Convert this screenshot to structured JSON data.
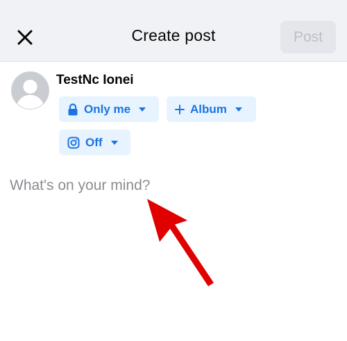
{
  "header": {
    "title": "Create post",
    "post_label": "Post"
  },
  "user": {
    "name": "TestNc Ionei"
  },
  "audience": {
    "privacy_label": "Only me",
    "album_label": "Album",
    "instagram_label": "Off"
  },
  "composer": {
    "placeholder": "What's on your mind?"
  },
  "colors": {
    "accent": "#1b74e4",
    "pill_bg": "#e7f3ff",
    "header_bg": "#f0f2f5",
    "annotation_arrow": "#e00000"
  },
  "icons": {
    "close": "close-icon",
    "privacy": "lock-icon",
    "album": "plus-icon",
    "instagram": "instagram-icon",
    "caret": "caret-down-icon"
  }
}
